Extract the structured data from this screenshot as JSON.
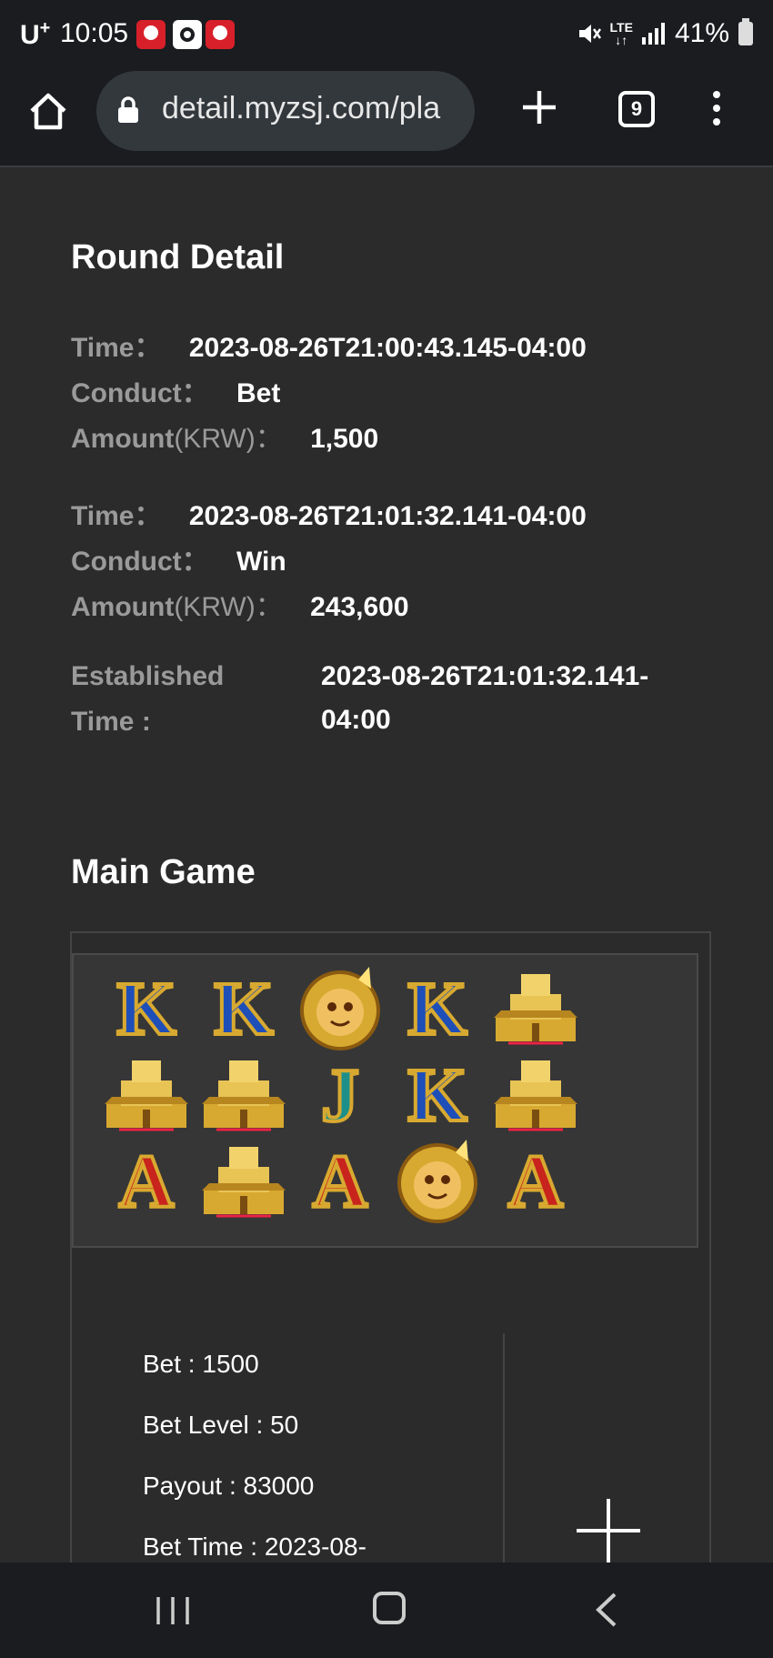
{
  "status_bar": {
    "carrier": "U",
    "carrier_sup": "+",
    "time": "10:05",
    "network": "LTE",
    "battery": "41%"
  },
  "browser": {
    "url": "detail.myzsj.com/pla",
    "tab_count": "9"
  },
  "round_detail": {
    "title": "Round Detail",
    "records": [
      {
        "time_label": "Time：",
        "time": "2023-08-26T21:00:43.145-04:00",
        "conduct_label": "Conduct：",
        "conduct": "Bet",
        "amount_label": "Amount",
        "amount_unit": "(KRW)：",
        "amount": "1,500"
      },
      {
        "time_label": "Time：",
        "time": "2023-08-26T21:01:32.141-04:00",
        "conduct_label": "Conduct：",
        "conduct": "Win",
        "amount_label": "Amount",
        "amount_unit": "(KRW)：",
        "amount": "243,600"
      }
    ],
    "established_label_1": "Established",
    "established_label_2": "Time :",
    "established_value_1": "2023-08-26T21:01:32.141-",
    "established_value_2": "04:00"
  },
  "main_game": {
    "title": "Main Game",
    "reels": [
      [
        "K",
        "K",
        "wild-monkey",
        "K",
        "temple"
      ],
      [
        "temple",
        "temple",
        "J",
        "K",
        "temple"
      ],
      [
        "A",
        "temple",
        "A",
        "wild-monkey",
        "A"
      ]
    ],
    "bet": "Bet : 1500",
    "bet_level": "Bet Level : 50",
    "payout": "Payout : 83000",
    "bet_time": "Bet Time : 2023-08-"
  },
  "colors": {
    "background": "#2b2b2b",
    "chrome": "#1a1c1f",
    "label_gray": "#9a9a9a",
    "symbol_blue": "#1e4fb8",
    "symbol_red": "#c8231c",
    "symbol_gold": "#d8a930"
  }
}
